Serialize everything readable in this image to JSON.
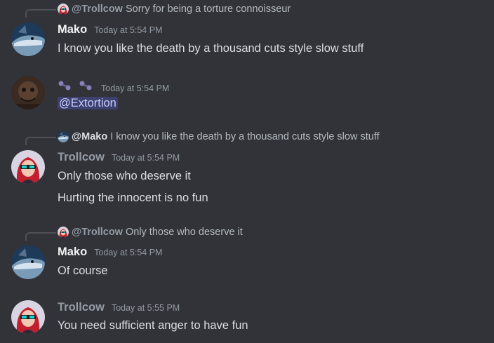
{
  "messages": [
    {
      "reply": {
        "author": "@Trollcow",
        "text": "Sorry for being a torture connoisseur"
      },
      "author": "Mako",
      "time": "Today at 5:54 PM",
      "lines": [
        "I know you like the death by a thousand cuts style slow stuff"
      ]
    },
    {
      "author": "",
      "author_icons": [
        "paw-emoji-icon",
        "paw-emoji-icon"
      ],
      "time": "Today at 5:54 PM",
      "mention": "@Extortion"
    },
    {
      "reply": {
        "author": "@Mako",
        "text": "I know you like the death by a thousand cuts style slow stuff"
      },
      "author": "Trollcow",
      "time": "Today at 5:54 PM",
      "lines": [
        "Only those who deserve it",
        "Hurting the innocent is no fun"
      ]
    },
    {
      "reply": {
        "author": "@Trollcow",
        "text": "Only those who deserve it"
      },
      "author": "Mako",
      "time": "Today at 5:54 PM",
      "lines": [
        "Of course"
      ]
    },
    {
      "author": "Trollcow",
      "time": "Today at 5:55 PM",
      "lines": [
        "You need sufficient anger to have fun"
      ]
    }
  ],
  "colors": {
    "background": "#313338",
    "text": "#dbdee1",
    "muted": "#949ba4",
    "mention_bg": "#3c4270",
    "mention_text": "#c9cdfb"
  }
}
